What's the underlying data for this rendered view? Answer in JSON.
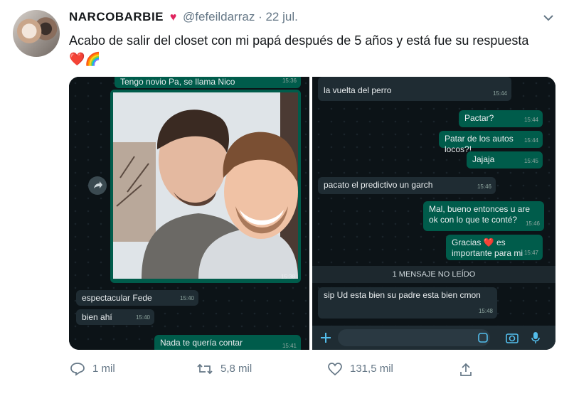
{
  "tweet": {
    "display_name": "NARCOBARBIE",
    "handle": "@fefeildarraz",
    "separator": "·",
    "date": "22 jul.",
    "text": "Acabo de salir del closet con mi papá después de 5 años y está fue su respuesta",
    "emojis": "❤️🌈"
  },
  "chat_left": {
    "top_message": "Tengo novio Pa, se llama Nico",
    "top_time": "15:36",
    "photo_time": "15:38",
    "messages": [
      {
        "text": "espectacular Fede",
        "time": "15:40"
      },
      {
        "text": "bien ahí",
        "time": "15:40"
      },
      {
        "text": "Nada te quería contar",
        "time": "15:41"
      }
    ]
  },
  "chat_right": {
    "messages": [
      {
        "text": "la vuelta del perro",
        "time": "15:44"
      },
      {
        "text": "Pactar?",
        "time": "15:44"
      },
      {
        "text": "Patar de los autos locos?!",
        "time": "15:44"
      },
      {
        "text": "Jajaja",
        "time": "15:45"
      },
      {
        "text": "pacato el predictivo un garch",
        "time": "15:46"
      },
      {
        "text": "Mal, bueno entonces u are ok con lo que te conté?",
        "time": "15:46"
      },
      {
        "text": "Gracias ❤️ es importante para mi",
        "time": "15:47"
      },
      {
        "text": "sip Ud esta bien su padre esta bien cmon",
        "time": "15:48"
      }
    ],
    "unread_banner": "1 MENSAJE NO LEÍDO"
  },
  "actions": {
    "replies": "1 mil",
    "retweets": "5,8 mil",
    "likes": "131,5 mil"
  },
  "colors": {
    "brand_heart": "#e0245e",
    "chat_bg": "#0c1317",
    "outgoing_bubble": "#005c4b",
    "incoming_bubble": "#1f2c33",
    "muted_text": "#657786"
  }
}
